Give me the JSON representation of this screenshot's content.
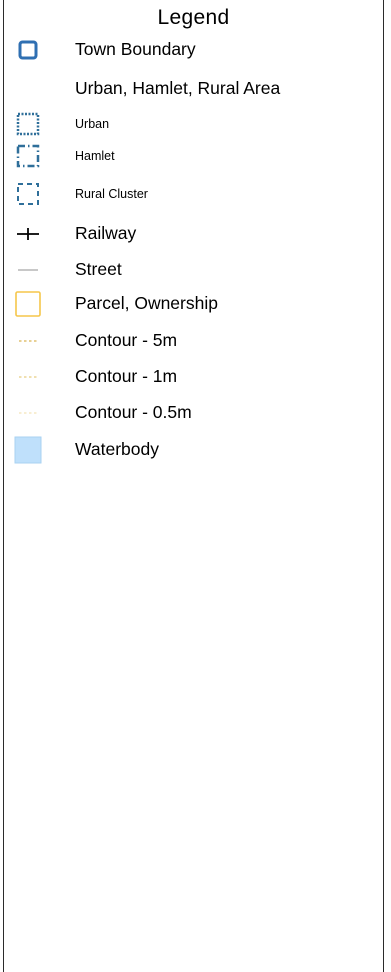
{
  "legend": {
    "title": "Legend",
    "items": [
      {
        "label": "Town Boundary",
        "icon": "town-boundary-icon",
        "color": "#2f6fb2"
      },
      {
        "label": "Urban, Hamlet, Rural Area"
      },
      {
        "label": "Urban",
        "icon": "urban-area-icon",
        "color": "#2f6f9a"
      },
      {
        "label": "Hamlet",
        "icon": "hamlet-area-icon",
        "color": "#2f6f9a"
      },
      {
        "label": "Rural Cluster",
        "icon": "rural-cluster-icon",
        "color": "#2f6f9a"
      },
      {
        "label": "Railway",
        "icon": "railway-icon",
        "color": "#000000"
      },
      {
        "label": "Street",
        "icon": "street-icon",
        "color": "#c8c8c8"
      },
      {
        "label": "Parcel, Ownership",
        "icon": "parcel-icon",
        "color": "#f5c64a"
      },
      {
        "label": "Contour - 5m",
        "icon": "contour-5m-icon",
        "color": "#e0c070"
      },
      {
        "label": "Contour - 1m",
        "icon": "contour-1m-icon",
        "color": "#ecd596"
      },
      {
        "label": "Contour - 0.5m",
        "icon": "contour-05m-icon",
        "color": "#f6e9c4"
      },
      {
        "label": "Waterbody",
        "icon": "waterbody-icon",
        "color": "#bfe0fb"
      }
    ]
  }
}
